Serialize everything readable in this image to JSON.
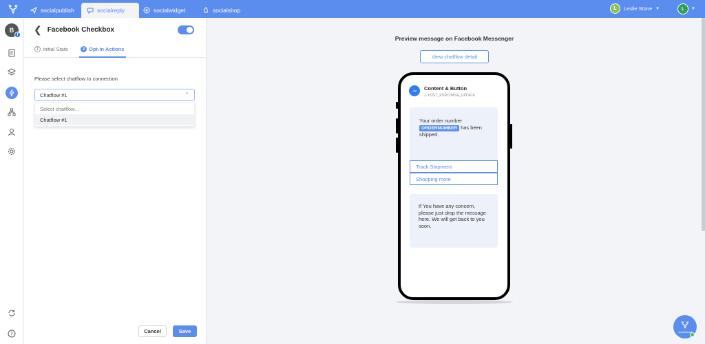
{
  "nav": {
    "tabs": [
      {
        "label": "socialpublish",
        "icon": "send-icon"
      },
      {
        "label": "socialreply",
        "icon": "chat-icon"
      },
      {
        "label": "socialwidget",
        "icon": "widget-icon"
      },
      {
        "label": "socialshop",
        "icon": "shop-icon"
      }
    ],
    "user_name": "Leslie Stone",
    "user_initial": "L",
    "account_initial": "L"
  },
  "sidebar": {
    "workspace_initial": "B",
    "badge": "f",
    "icons": [
      "document-icon",
      "layers-icon",
      "bolt-icon",
      "sitemap-icon",
      "user-icon",
      "settings-icon",
      "sync-icon",
      "help-icon"
    ]
  },
  "panel": {
    "title": "Facebook Checkbox",
    "steps": [
      {
        "num": "1",
        "label": "Initial State"
      },
      {
        "num": "2",
        "label": "Opt-in Actions"
      }
    ],
    "prompt": "Please select chatflow to connection",
    "select_value": "Chatflow #1",
    "dropdown": {
      "placeholder": "Select chatflow...",
      "options": [
        "Chatflow #1"
      ]
    },
    "cancel_label": "Cancel",
    "save_label": "Save"
  },
  "preview": {
    "title": "Preview message on Facebook Messenger",
    "detail_button": "View chatflow detail",
    "msg_title": "Content & Button",
    "msg_tag": "POST_PURCHASE_UPDATE",
    "bubble1_pre": "Your order number",
    "bubble1_chip": "ORDERNUMBER",
    "bubble1_post": "has been shipped.",
    "buttons": [
      "Track Shipment",
      "Shopping more"
    ],
    "bubble2": "If You have any concern, please just drop the message here. We will get back to you soon."
  },
  "float_logo_text": "socialhead",
  "colors": {
    "brand": "#5b8def",
    "messenger": "#2f7cf6"
  }
}
